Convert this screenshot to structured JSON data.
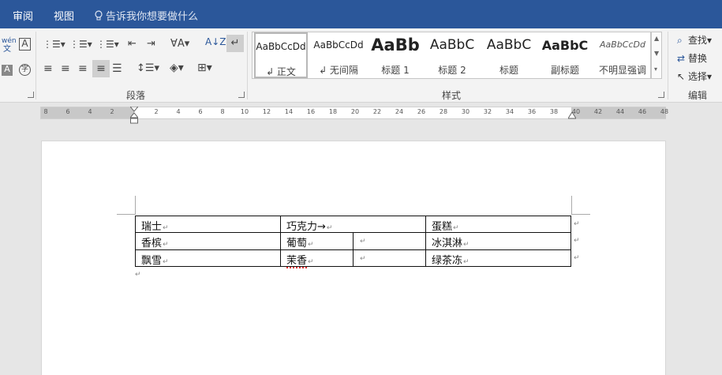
{
  "menubar": {
    "tabs": [
      "审阅",
      "视图"
    ],
    "tell_me": "告诉我你想要做什么"
  },
  "ribbon": {
    "paragraph_group_label": "段落",
    "styles_group_label": "样式",
    "editing_group_label": "编辑",
    "styles": [
      {
        "sample": "AaBbCcDd",
        "label": "↲ 正文"
      },
      {
        "sample": "AaBbCcDd",
        "label": "↲ 无间隔"
      },
      {
        "sample": "AaBb",
        "label": "标题 1"
      },
      {
        "sample": "AaBbC",
        "label": "标题 2"
      },
      {
        "sample": "AaBbC",
        "label": "标题"
      },
      {
        "sample": "AaBbC",
        "label": "副标题"
      },
      {
        "sample": "AaBbCcDd",
        "label": "不明显强调"
      }
    ],
    "editing": {
      "find": "查找",
      "replace": "替换",
      "select": "选择"
    },
    "phonetic_label": "wén"
  },
  "ruler": {
    "left_numbers": [
      "8",
      "6",
      "4",
      "2"
    ],
    "right_numbers": [
      "2",
      "4",
      "6",
      "8",
      "10",
      "12",
      "14",
      "16",
      "18",
      "20",
      "22",
      "24",
      "26",
      "28",
      "30",
      "32",
      "34",
      "36",
      "38",
      "40",
      "42",
      "44",
      "46",
      "48"
    ]
  },
  "document": {
    "table": {
      "rows": [
        [
          "瑞士",
          "巧克力→",
          "",
          "蛋糕"
        ],
        [
          "香槟",
          "葡萄",
          "",
          "冰淇淋"
        ],
        [
          "飘雪",
          "茉香",
          "",
          "绿茶冻"
        ]
      ]
    },
    "paragraph_mark": "↵",
    "cell_mark": "↵"
  }
}
